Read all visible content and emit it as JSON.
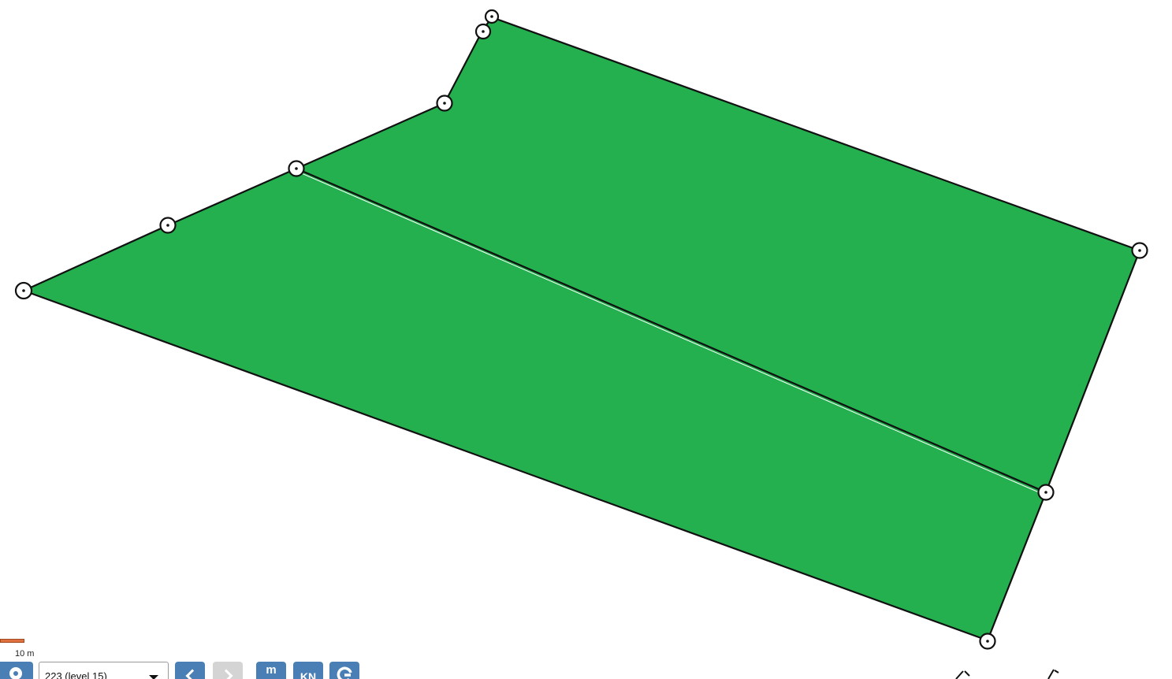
{
  "map": {
    "parcel_fill": "#24b04e",
    "line_color": "#111111"
  },
  "scale": {
    "label": "10 m",
    "bar_color": "#e07040"
  },
  "toolbar": {
    "level_select_value": "223 (level 15)",
    "m_label": "m",
    "kn_label": "KN",
    "button_color": "#4a7fb5",
    "disabled_color": "#d4d4d4"
  },
  "icons": {
    "location": "map-pin-icon",
    "prev": "chevron-left-icon",
    "next": "chevron-right-icon",
    "g": "g-logo-icon",
    "dropdown": "chevron-down-icon",
    "marker": "boundary-marker-icon"
  }
}
